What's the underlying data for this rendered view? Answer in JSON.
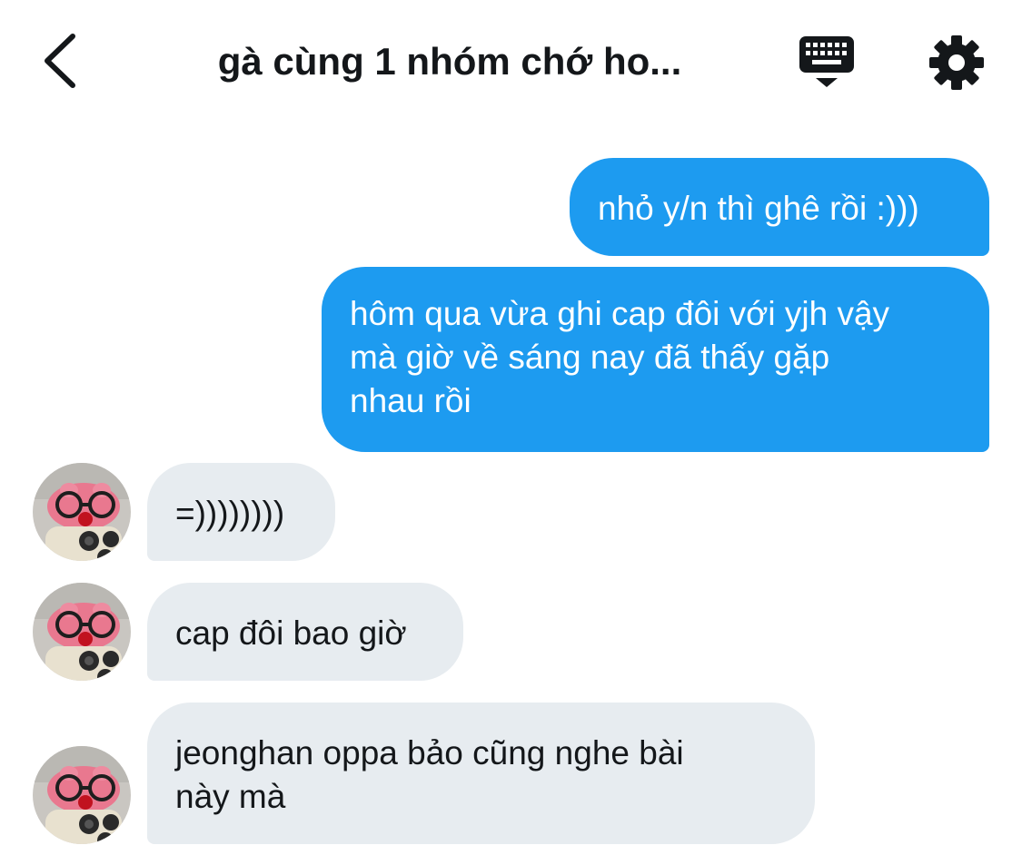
{
  "header": {
    "title": "gà cùng 1 nhóm chớ ho...",
    "back_icon": "chevron-left-icon",
    "keyboard_icon": "keyboard-icon",
    "settings_icon": "gear-icon"
  },
  "colors": {
    "outgoing_bubble": "#1d9bf0",
    "incoming_bubble": "#e7ecf0",
    "text": "#14171a"
  },
  "messages": [
    {
      "direction": "outgoing",
      "text": "nhỏ y/n thì ghê rồi :)))"
    },
    {
      "direction": "outgoing",
      "lines": [
        "hôm qua vừa ghi cap đôi với yjh vậy",
        "mà giờ về sáng nay đã thấy gặp",
        "nhau rồi"
      ]
    },
    {
      "direction": "incoming",
      "text": "=))))))))"
    },
    {
      "direction": "incoming",
      "text": "cap đôi bao giờ"
    },
    {
      "direction": "incoming",
      "lines": [
        "jeonghan oppa bảo cũng nghe bài",
        "này mà"
      ]
    }
  ]
}
